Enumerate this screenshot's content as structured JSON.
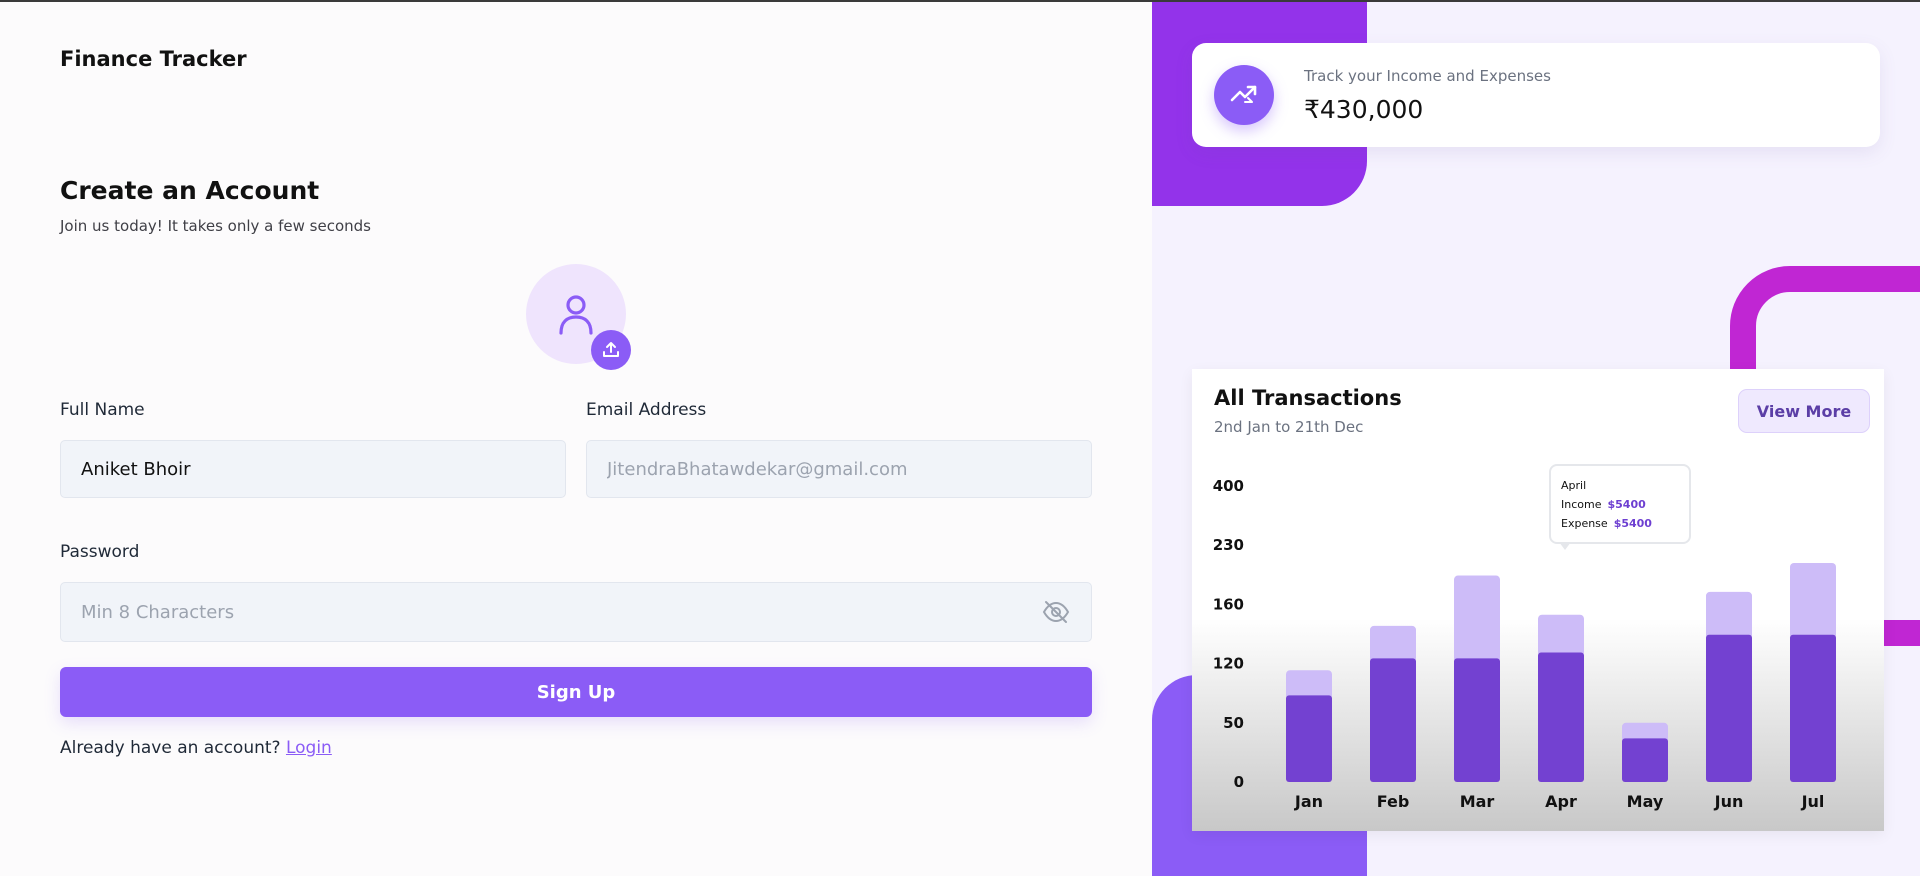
{
  "app": {
    "brand": "Finance Tracker"
  },
  "form": {
    "heading": "Create an Account",
    "subheading": "Join us today! It takes only a few seconds",
    "full_name": {
      "label": "Full Name",
      "value": "Aniket Bhoir",
      "placeholder": ""
    },
    "email": {
      "label": "Email Address",
      "value": "",
      "placeholder": "JitendraBhatawdekar@gmail.com"
    },
    "password": {
      "label": "Password",
      "value": "",
      "placeholder": "Min 8 Characters"
    },
    "submit_label": "Sign Up",
    "login_prompt": "Already have an account?",
    "login_link": "Login",
    "icons": {
      "avatar": "user-icon",
      "upload": "upload-icon",
      "password_toggle": "eye-off-icon"
    }
  },
  "stat_card": {
    "label": "Track your Income and Expenses",
    "value": "₹430,000",
    "icon": "trending-up-icon"
  },
  "transactions": {
    "title": "All Transactions",
    "subtitle": "2nd Jan to 21th Dec",
    "view_more": "View More",
    "tooltip": {
      "month": "April",
      "income_label": "Income",
      "income_value": "$5400",
      "expense_label": "Expense",
      "expense_value": "$5400"
    }
  },
  "colors": {
    "accent": "#8b5cf6",
    "deep_purple": "#9333ea",
    "magenta": "#c026d3",
    "bar_dark": "#7341d1",
    "bar_light": "#cdbcf8"
  },
  "chart_data": {
    "type": "bar",
    "stacked": true,
    "categories": [
      "Jan",
      "Feb",
      "Mar",
      "Apr",
      "May",
      "Jul"
    ],
    "categories_all": [
      "Jan",
      "Feb",
      "Mar",
      "Apr",
      "May",
      "Jun",
      "Jul"
    ],
    "y_ticks": [
      "0",
      "50",
      "120",
      "160",
      "230",
      "400"
    ],
    "series": [
      {
        "name": "Income",
        "values": [
          117,
          167,
          167,
          175,
          59,
          199,
          199
        ]
      },
      {
        "name": "Expense",
        "values": [
          34,
          44,
          112,
          51,
          21,
          58,
          97
        ]
      }
    ],
    "ylim": [
      0,
      400
    ],
    "grid": false,
    "legend": "none"
  }
}
